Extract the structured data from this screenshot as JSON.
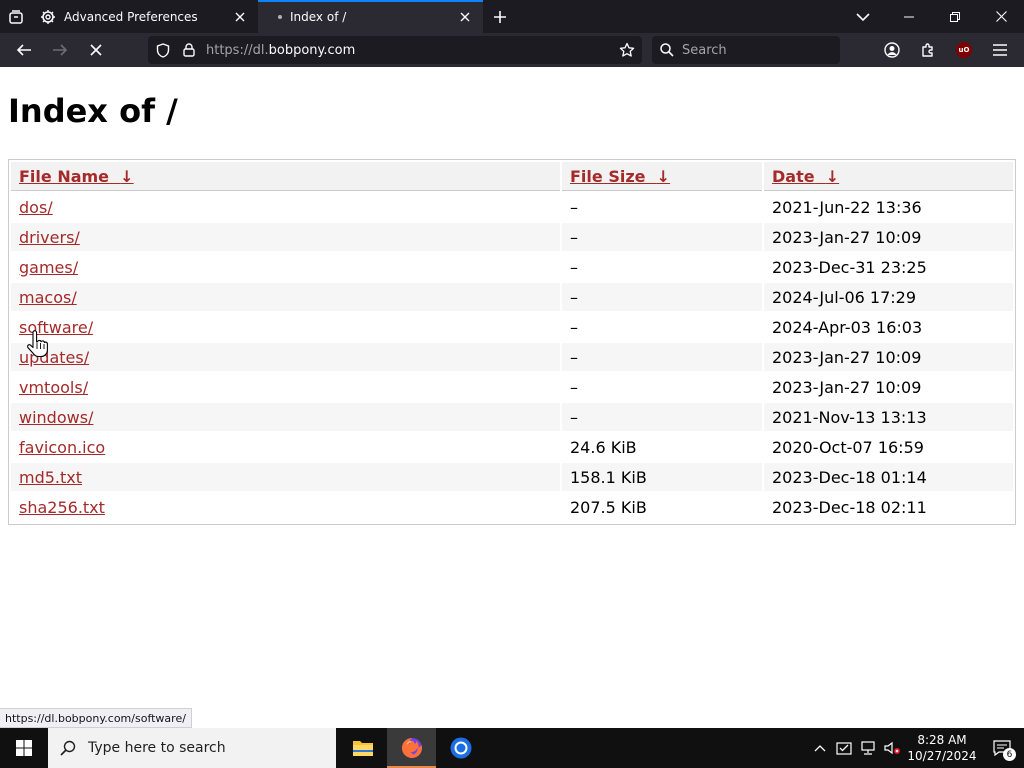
{
  "browser": {
    "tabs": [
      {
        "title": "Advanced Preferences",
        "active": false,
        "icon": "gear-icon"
      },
      {
        "title": "Index of /",
        "active": true,
        "icon": "loading-dot"
      }
    ],
    "url": {
      "prefix": "https://dl.",
      "domain": "bobpony.com"
    },
    "search_placeholder": "Search",
    "status_link": "https://dl.bobpony.com/software/"
  },
  "page": {
    "heading": "Index of /",
    "columns": [
      "File Name",
      "File Size",
      "Date"
    ],
    "sort_arrow": "↓",
    "rows": [
      {
        "name": "dos/",
        "size": "–",
        "date": "2021-Jun-22 13:36"
      },
      {
        "name": "drivers/",
        "size": "–",
        "date": "2023-Jan-27 10:09"
      },
      {
        "name": "games/",
        "size": "–",
        "date": "2023-Dec-31 23:25"
      },
      {
        "name": "macos/",
        "size": "–",
        "date": "2024-Jul-06 17:29"
      },
      {
        "name": "software/",
        "size": "–",
        "date": "2024-Apr-03 16:03"
      },
      {
        "name": "updates/",
        "size": "–",
        "date": "2023-Jan-27 10:09"
      },
      {
        "name": "vmtools/",
        "size": "–",
        "date": "2023-Jan-27 10:09"
      },
      {
        "name": "windows/",
        "size": "–",
        "date": "2021-Nov-13 13:13"
      },
      {
        "name": "favicon.ico",
        "size": "24.6 KiB",
        "date": "2020-Oct-07 16:59"
      },
      {
        "name": "md5.txt",
        "size": "158.1 KiB",
        "date": "2023-Dec-18 01:14"
      },
      {
        "name": "sha256.txt",
        "size": "207.5 KiB",
        "date": "2023-Dec-18 02:11"
      }
    ]
  },
  "taskbar": {
    "search_placeholder": "Type here to search",
    "time": "8:28 AM",
    "date": "10/27/2024",
    "notification_count": "6"
  },
  "colors": {
    "link": "#a52a2a",
    "tab_accent": "#0a84ff",
    "browser_dark": "#1c1b22",
    "toolbar": "#2b2a33"
  }
}
